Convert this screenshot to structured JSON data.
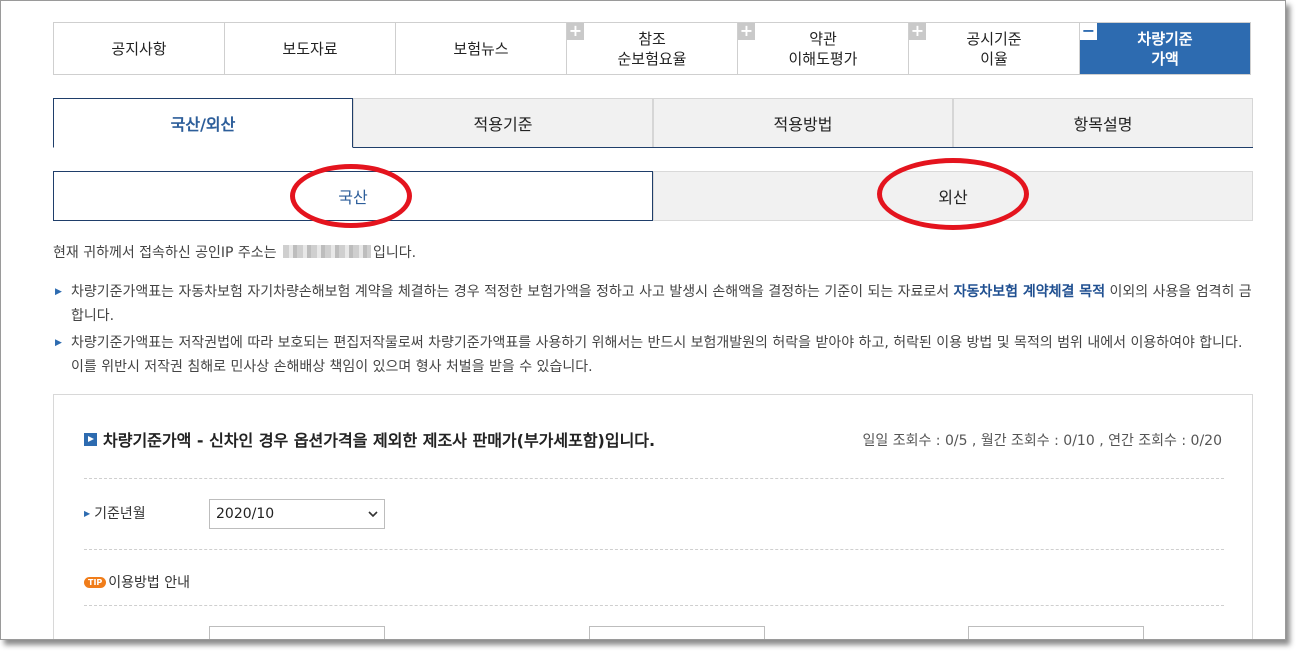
{
  "top_nav": [
    {
      "label": "공지사항",
      "plus": false,
      "active": false
    },
    {
      "label": "보도자료",
      "plus": false,
      "active": false
    },
    {
      "label": "보험뉴스",
      "plus": false,
      "active": false
    },
    {
      "label": "참조\n순보험요율",
      "plus": true,
      "active": false
    },
    {
      "label": "약관\n이해도평가",
      "plus": true,
      "active": false
    },
    {
      "label": "공시기준\n이율",
      "plus": true,
      "active": false
    },
    {
      "label": "차량기준\n가액",
      "plus": true,
      "active": true
    }
  ],
  "plus_glyph": "+",
  "minus_glyph": "−",
  "sub_tabs": [
    "국산/외산",
    "적용기준",
    "적용방법",
    "항목설명"
  ],
  "toggle": {
    "domestic": "국산",
    "foreign": "외산"
  },
  "ip_notice": {
    "before": "현재 귀하께서 접속하신 공인IP 주소는",
    "after": "입니다."
  },
  "notes": {
    "n1_a": "차량기준가액표는 자동차보험 자기차량손해보험 계약을 체결하는 경우 적정한 보험가액을 정하고 사고 발생시 손해액을 결정하는 기준이 되는 자료로서 ",
    "n1_hl": "자동차보험 계약체결 목적",
    "n1_b": " 이외의 사용을 엄격히 금합니다.",
    "n2": "차량기준가액표는 저작권법에 따라 보호되는 편집저작물로써 차량기준가액표를 사용하기 위해서는 반드시 보험개발원의 허락을 받아야 하고, 허락된 이용 방법 및 목적의 범위 내에서 이용하여야 합니다. 이를 위반시 저작권 침해로 민사상 손해배상 책임이 있으며 형사 처벌을 받을 수 있습니다."
  },
  "panel": {
    "title": "차량기준가액 - 신차인 경우 옵션가격을 제외한 제조사 판매가(부가세포함)입니다.",
    "counts": "일일 조회수 : 0/5 , 월간 조회수 : 0/10 , 연간 조회수 : 0/20",
    "base_month_label": "기준년월",
    "base_month_value": "2020/10",
    "tip_badge": "TIP",
    "usage_label": "이용방법 안내"
  },
  "icons": {
    "bullet": "▶",
    "row_marker": "▶",
    "dropdown": "chevron-down-icon"
  },
  "colors": {
    "accent": "#2d6bb0",
    "annotation_ring": "#e4141e",
    "tip": "#f07d1a"
  }
}
